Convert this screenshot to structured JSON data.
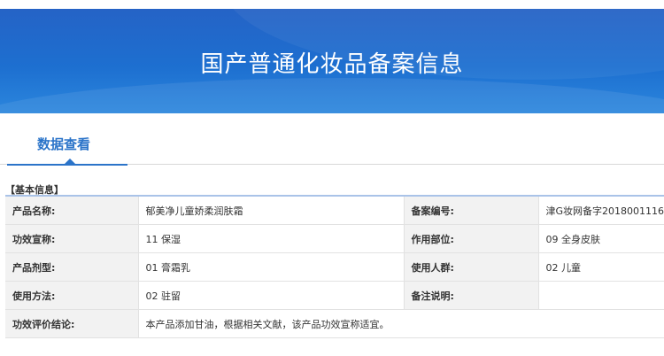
{
  "banner": {
    "title": "国产普通化妆品备案信息"
  },
  "tabs": [
    {
      "label": "数据查看",
      "active": true
    }
  ],
  "section": {
    "title": "【基本信息】"
  },
  "rows": [
    {
      "label1": "产品名称:",
      "value1": "郁美净儿童娇柔润肤霜",
      "label2": "备案编号:",
      "value2": "津G妆网备字2018001116"
    },
    {
      "label1": "功效宣称:",
      "value1": "11 保湿",
      "label2": "作用部位:",
      "value2": "09 全身皮肤"
    },
    {
      "label1": "产品剂型:",
      "value1": "01 膏霜乳",
      "label2": "使用人群:",
      "value2": "02 儿童"
    },
    {
      "label1": "使用方法:",
      "value1": "02 驻留",
      "label2": "备注说明:",
      "value2": ""
    }
  ],
  "conclusion": {
    "label": "功效评价结论:",
    "value": "本产品添加甘油，根据相关文献，该产品功效宣称适宜。"
  },
  "colors": {
    "banner": "#1d6fd0",
    "accent": "#2b74c9",
    "label_bg": "#f2f2f2"
  }
}
